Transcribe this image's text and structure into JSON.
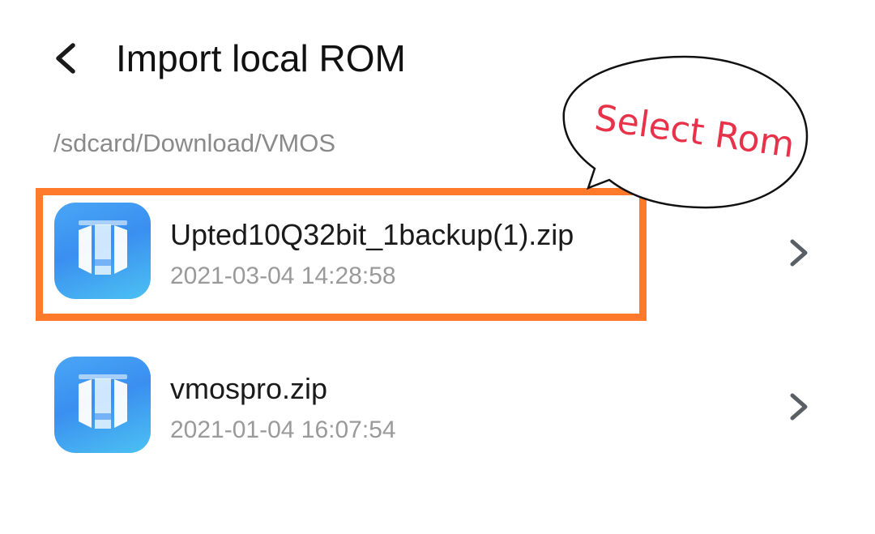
{
  "header": {
    "title": "Import local ROM",
    "back_icon": "chevron-left-icon"
  },
  "breadcrumb": {
    "path": "/sdcard/Download/VMOS"
  },
  "files": [
    {
      "name": "Upted10Q32bit_1backup(1).zip",
      "date": "2021-03-04 14:28:58",
      "icon": "vmos-app-icon",
      "highlighted": true
    },
    {
      "name": "vmospro.zip",
      "date": "2021-01-04 16:07:54",
      "icon": "vmos-app-icon",
      "highlighted": false
    }
  ],
  "annotation": {
    "bubble_text": "Select Rom",
    "highlight_color": "#ff7a2a",
    "text_color": "#e8324a"
  },
  "colors": {
    "icon_blue": "#3a8ff0",
    "chevron": "#5a5f66"
  }
}
